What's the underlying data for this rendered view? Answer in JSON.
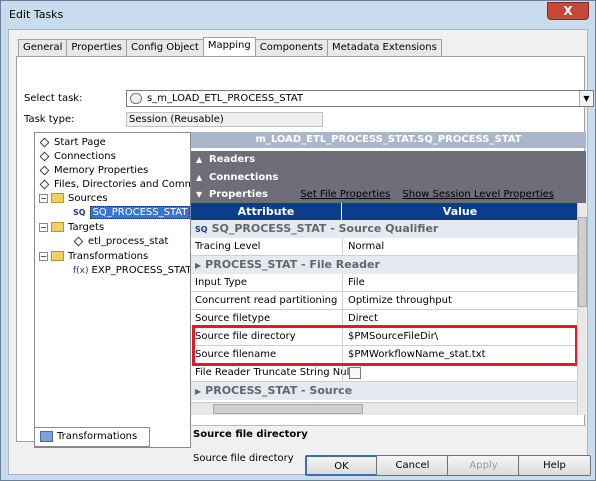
{
  "window": {
    "title": "Edit Tasks",
    "close_glyph": "X"
  },
  "tabs": [
    "General",
    "Properties",
    "Config Object",
    "Mapping",
    "Components",
    "Metadata Extensions"
  ],
  "active_tab": "Mapping",
  "select_task": {
    "label": "Select task:",
    "value": "s_m_LOAD_ETL_PROCESS_STAT",
    "dropdown_glyph": "▼"
  },
  "task_type": {
    "label": "Task type:",
    "value": "Session (Reusable)"
  },
  "tree": {
    "items": [
      {
        "label": "Start Page"
      },
      {
        "label": "Connections"
      },
      {
        "label": "Memory Properties"
      },
      {
        "label": "Files, Directories and Comm"
      }
    ],
    "sources": {
      "label": "Sources",
      "toggle": "−",
      "child": "SQ_PROCESS_STAT",
      "child_badge": "SQ"
    },
    "targets": {
      "label": "Targets",
      "toggle": "−",
      "child": "etl_process_stat"
    },
    "transformations": {
      "label": "Transformations",
      "toggle": "−",
      "child": "EXP_PROCESS_STAT",
      "child_badge": "f(x)"
    }
  },
  "bottom_tab": "Transformations",
  "panel_header": "m_LOAD_ETL_PROCESS_STAT.SQ_PROCESS_STAT",
  "bars": {
    "readers": "Readers",
    "connections": "Connections",
    "properties": "Properties",
    "set_file_properties": "Set File Properties",
    "show_session_level": "Show Session Level Properties",
    "collapsed_glyph": "▲",
    "expanded_glyph": "▼"
  },
  "grid": {
    "col_attribute": "Attribute",
    "col_value": "Value",
    "section1": "SQ_PROCESS_STAT - Source Qualifier",
    "section1_badge": "SQ",
    "section2": "PROCESS_STAT - File Reader",
    "section3": "PROCESS_STAT - Source",
    "section_glyph": "▶",
    "rows": [
      {
        "attr": "Tracing Level",
        "value": "Normal"
      },
      {
        "attr": "Input Type",
        "value": "File"
      },
      {
        "attr": "Concurrent read partitioning",
        "value": "Optimize throughput"
      },
      {
        "attr": "Source filetype",
        "value": "Direct"
      },
      {
        "attr": "Source file directory",
        "value": "$PMSourceFileDir\\"
      },
      {
        "attr": "Source filename",
        "value": "$PMWorkflowName_stat.txt"
      },
      {
        "attr": "File Reader Truncate String Null",
        "value": ""
      }
    ]
  },
  "description": {
    "title": "Source file directory",
    "body": "Source file directory"
  },
  "buttons": {
    "ok": "OK",
    "cancel": "Cancel",
    "apply": "Apply",
    "help": "Help"
  }
}
